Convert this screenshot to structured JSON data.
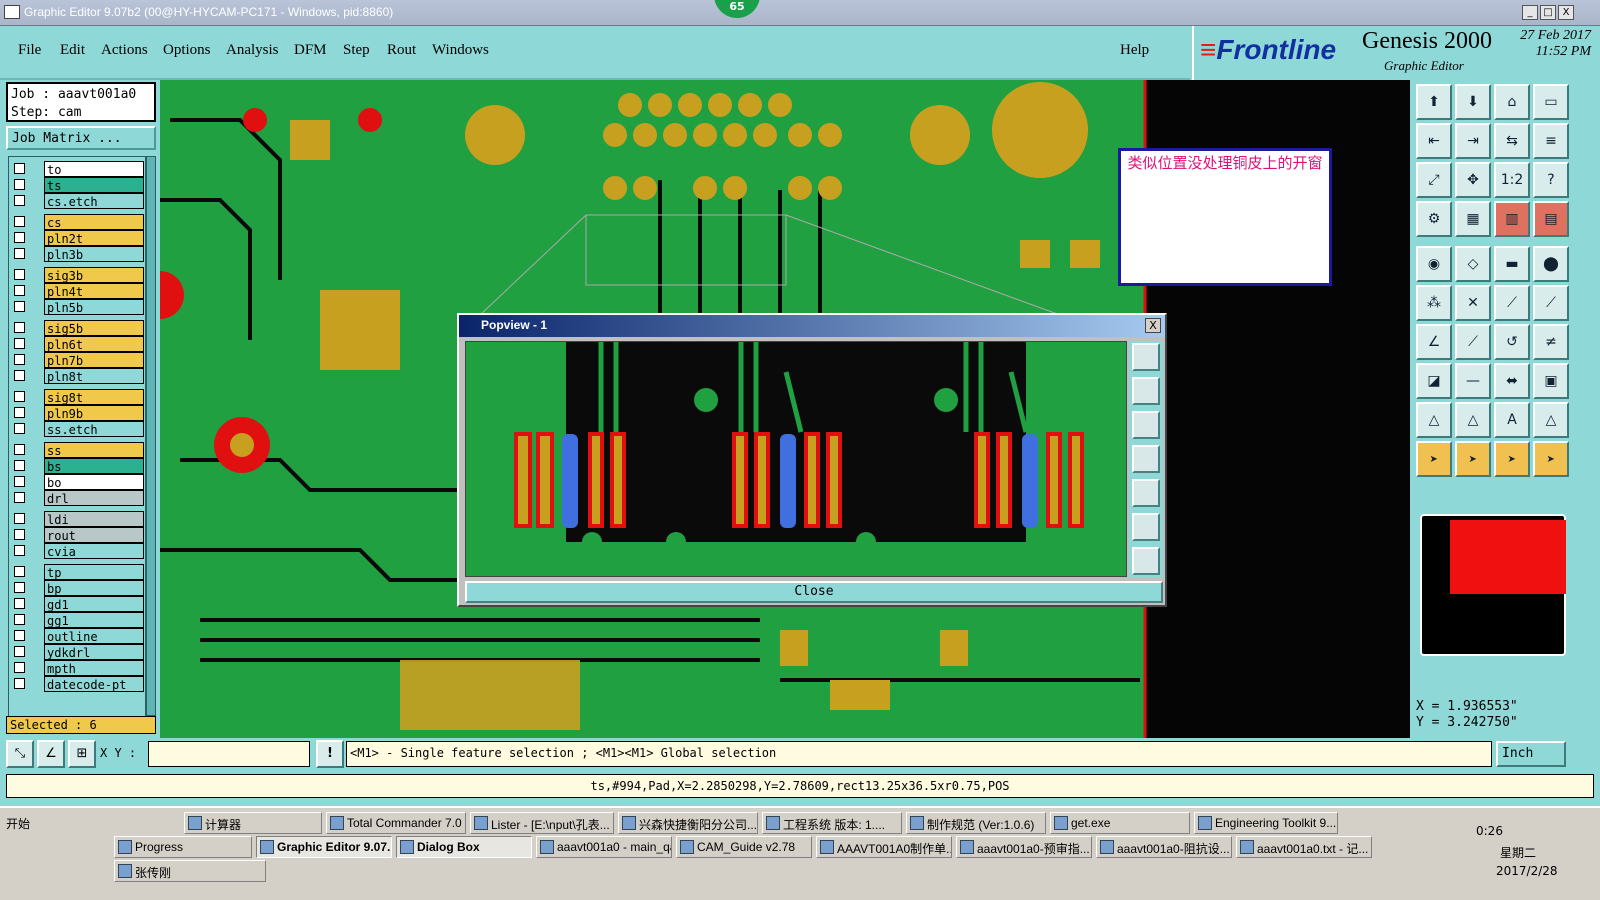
{
  "window": {
    "title": "Graphic Editor 9.07b2 (00@HY-HYCAM-PC171 - Windows, pid:8860)",
    "badge": "65",
    "min": "_",
    "max": "□",
    "close": "X"
  },
  "menu": {
    "file": "File",
    "edit": "Edit",
    "actions": "Actions",
    "options": "Options",
    "analysis": "Analysis",
    "dfm": "DFM",
    "step": "Step",
    "rout": "Rout",
    "windows": "Windows",
    "help": "Help"
  },
  "brand": {
    "frontline_a": "Frontline",
    "genesis": "Genesis 2000",
    "graphic_editor": "Graphic Editor",
    "date": "27 Feb 2017",
    "time": "11:52 PM"
  },
  "job": {
    "job_line": "Job : aaavt001a0",
    "step_line": "Step: cam",
    "job_matrix": "Job Matrix ..."
  },
  "layers": [
    {
      "name": "to",
      "bg": "#ffffff"
    },
    {
      "name": "ts",
      "bg": "#2bb090"
    },
    {
      "name": "cs.etch",
      "bg": "#8fd8d8"
    },
    {
      "name": "cs",
      "bg": "#f0c84a"
    },
    {
      "name": "pln2t",
      "bg": "#f0c84a"
    },
    {
      "name": "pln3b",
      "bg": "#8fd8d8"
    },
    {
      "name": "sig3b",
      "bg": "#f0c84a"
    },
    {
      "name": "pln4t",
      "bg": "#f0c84a"
    },
    {
      "name": "pln5b",
      "bg": "#8fd8d8"
    },
    {
      "name": "sig5b",
      "bg": "#f0c84a"
    },
    {
      "name": "pln6t",
      "bg": "#f0c84a"
    },
    {
      "name": "pln7b",
      "bg": "#f0c84a"
    },
    {
      "name": "pln8t",
      "bg": "#8fd8d8"
    },
    {
      "name": "sig8t",
      "bg": "#f0c84a"
    },
    {
      "name": "pln9b",
      "bg": "#f0c84a"
    },
    {
      "name": "ss.etch",
      "bg": "#8fd8d8"
    },
    {
      "name": "ss",
      "bg": "#f0c84a"
    },
    {
      "name": "bs",
      "bg": "#2bb090"
    },
    {
      "name": "bo",
      "bg": "#ffffff"
    },
    {
      "name": "drl",
      "bg": "#b8c8c8"
    },
    {
      "name": "ldi",
      "bg": "#b8c8c8"
    },
    {
      "name": "rout",
      "bg": "#b8c8c8"
    },
    {
      "name": "cvia",
      "bg": "#8fd8d8"
    },
    {
      "name": "tp",
      "bg": "#8fd8d8"
    },
    {
      "name": "bp",
      "bg": "#8fd8d8"
    },
    {
      "name": "gd1",
      "bg": "#8fd8d8"
    },
    {
      "name": "gg1",
      "bg": "#8fd8d8"
    },
    {
      "name": "outline",
      "bg": "#8fd8d8"
    },
    {
      "name": "ydkdrl",
      "bg": "#8fd8d8"
    },
    {
      "name": "mpth",
      "bg": "#8fd8d8"
    },
    {
      "name": "datecode-pt",
      "bg": "#8fd8d8"
    }
  ],
  "selected": "Selected : 6",
  "note": "类似位置没处理铜皮上的开窗",
  "popview": {
    "title": "Popview - 1",
    "close_label": "Close",
    "x": "X"
  },
  "coords": {
    "x": "X =  1.936553\"",
    "y": "Y =  3.242750\""
  },
  "status": {
    "xy_label": "X Y :",
    "hint": "<M1> - Single feature selection ; <M1><M1> Global selection",
    "unit": "Inch",
    "feature": "ts,#994,Pad,X=2.2850298,Y=2.78609,rect13.25x36.5xr0.75,POS"
  },
  "taskbar": {
    "start": "开始",
    "row1": [
      "计算器",
      "Total Commander 7.0 ...",
      "Lister - [E:\\nput\\孔表...",
      "兴森快捷衡阳分公司...",
      "工程系统  版本: 1....",
      "制作规范 (Ver:1.0.6)",
      "get.exe",
      "Engineering Toolkit 9...."
    ],
    "row2": [
      "Progress",
      "Graphic Editor 9.07...",
      "Dialog Box",
      "aaavt001a0 - main_qa",
      "CAM_Guide v2.78",
      "AAAVT001A0制作单...",
      "aaavt001a0-预审指...",
      "aaavt001a0-阻抗设...",
      "aaavt001a0.txt - 记..."
    ],
    "row3": [
      "张传刚"
    ],
    "clock": "0:26",
    "weekday": "星期二",
    "date": "2017/2/28"
  },
  "colors": {
    "board": "#20a040",
    "trace": "#2eb040",
    "pad": "#c8a020",
    "red": "#e01010",
    "blue": "#4070e0",
    "bg": "#8fd8d8"
  }
}
